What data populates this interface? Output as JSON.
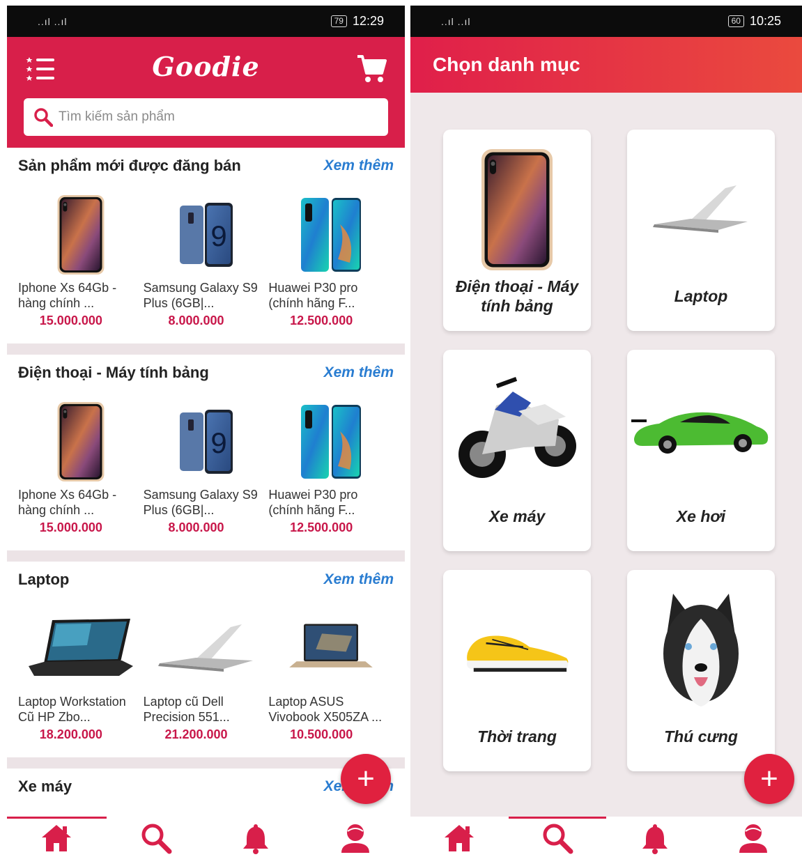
{
  "left": {
    "status": {
      "signal": "..ıl ..ıl",
      "battery": "79",
      "time": "12:29"
    },
    "brand": "Goodie",
    "search_placeholder": "Tìm kiếm sản phẩm",
    "see_more": "Xem thêm",
    "sections": [
      {
        "title": "Sản phẩm mới được đăng bán",
        "products": [
          {
            "name": "Iphone Xs 64Gb - hàng chính ...",
            "price": "15.000.000"
          },
          {
            "name": "Samsung Galaxy S9 Plus (6GB|...",
            "price": "8.000.000"
          },
          {
            "name": "Huawei P30 pro (chính hãng F...",
            "price": "12.500.000"
          }
        ]
      },
      {
        "title": "Điện thoại - Máy tính bảng",
        "products": [
          {
            "name": "Iphone Xs 64Gb - hàng chính ...",
            "price": "15.000.000"
          },
          {
            "name": "Samsung Galaxy S9 Plus (6GB|...",
            "price": "8.000.000"
          },
          {
            "name": "Huawei P30 pro (chính hãng F...",
            "price": "12.500.000"
          }
        ]
      },
      {
        "title": "Laptop",
        "products": [
          {
            "name": "Laptop Workstation Cũ HP Zbo...",
            "price": "18.200.000"
          },
          {
            "name": "Laptop cũ Dell Precision 551...",
            "price": "21.200.000"
          },
          {
            "name": "Laptop ASUS Vivobook X505ZA ...",
            "price": "10.500.000"
          }
        ]
      },
      {
        "title": "Xe máy",
        "products": []
      }
    ],
    "fab_label": "+",
    "nav": [
      "home-icon",
      "search-icon",
      "bell-icon",
      "user-icon"
    ],
    "nav_active": "home"
  },
  "right": {
    "status": {
      "battery": "60",
      "time": "10:25"
    },
    "title": "Chọn danh mục",
    "categories": [
      {
        "label": "Điện thoại - Máy tính bảng",
        "icon": "phone-image"
      },
      {
        "label": "Laptop",
        "icon": "laptop-image"
      },
      {
        "label": "Xe máy",
        "icon": "motorbike-image"
      },
      {
        "label": "Xe hơi",
        "icon": "car-image"
      },
      {
        "label": "Thời trang",
        "icon": "sneaker-image"
      },
      {
        "label": "Thú cưng",
        "icon": "dog-image"
      }
    ],
    "fab_label": "+",
    "nav_active": "search"
  },
  "colors": {
    "primary": "#d81f4a",
    "link": "#2a7dd1",
    "price": "#c8174a"
  }
}
